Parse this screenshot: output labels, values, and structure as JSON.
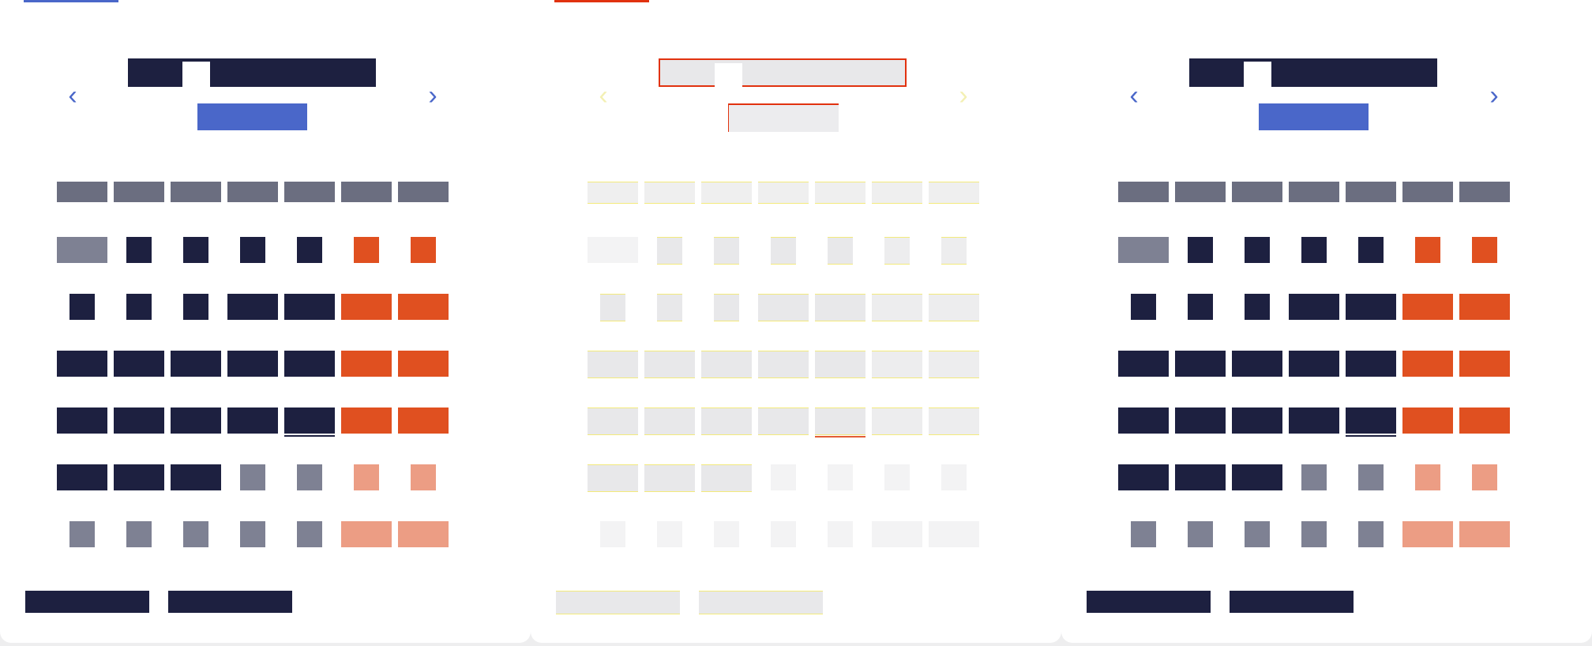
{
  "app": {
    "title": ""
  },
  "panels": [
    {
      "name": "calendar-panel-1",
      "accent": "#4a67c9"
    },
    {
      "name": "calendar-panel-2",
      "accent": "#e1320f"
    },
    {
      "name": "calendar-panel-3",
      "accent": ""
    }
  ],
  "nav": {
    "prev_label": "‹",
    "next_label": "›"
  },
  "colors": {
    "dark": "#1d2040",
    "blue": "#4a67c9",
    "weekend": "#e05020",
    "muted": "#7e8193",
    "muted_weekend": "#ec9d84",
    "header": "#6b6e80"
  }
}
